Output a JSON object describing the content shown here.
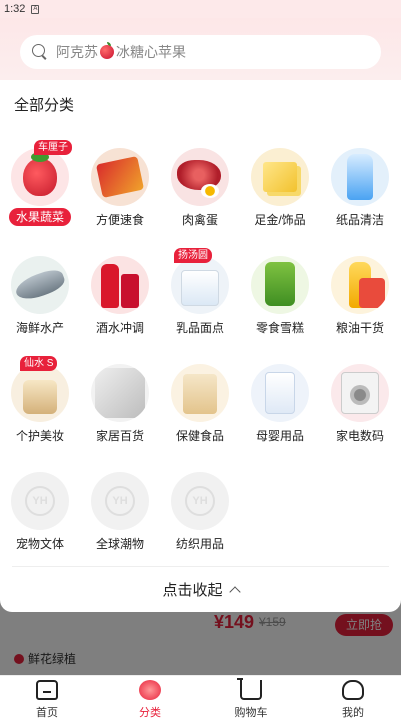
{
  "status_bar": {
    "time": "1:32"
  },
  "search": {
    "placeholder_before": "阿克苏",
    "placeholder_after": "冰糖心苹果"
  },
  "panel": {
    "title": "全部分类",
    "collapse_label": "点击收起",
    "categories": [
      {
        "label": "水果蔬菜",
        "badge": "车厘子",
        "icon": "strawberry-icon",
        "active": true
      },
      {
        "label": "方便速食",
        "icon": "instant-noodle-icon"
      },
      {
        "label": "肉禽蛋",
        "icon": "meat-icon"
      },
      {
        "label": "足金/饰品",
        "icon": "gold-icon"
      },
      {
        "label": "纸品清洁",
        "icon": "detergent-icon"
      },
      {
        "label": "海鲜水产",
        "icon": "fish-icon"
      },
      {
        "label": "酒水冲调",
        "icon": "cola-icon"
      },
      {
        "label": "乳品面点",
        "badge": "扬汤圆",
        "icon": "milk-icon"
      },
      {
        "label": "零食雪糕",
        "icon": "chips-icon"
      },
      {
        "label": "粮油干货",
        "icon": "oil-icon"
      },
      {
        "label": "个护美妆",
        "badge": "仙水 S",
        "icon": "skincare-icon"
      },
      {
        "label": "家居百货",
        "icon": "household-icon"
      },
      {
        "label": "保健食品",
        "icon": "health-food-icon"
      },
      {
        "label": "母婴用品",
        "icon": "baby-formula-icon"
      },
      {
        "label": "家电数码",
        "icon": "washer-icon"
      },
      {
        "label": "宠物文体",
        "icon": "placeholder-logo-icon"
      },
      {
        "label": "全球潮物",
        "icon": "placeholder-logo-icon"
      },
      {
        "label": "纺织用品",
        "icon": "placeholder-logo-icon"
      }
    ]
  },
  "background": {
    "price": "¥149",
    "old_price": "¥159",
    "buy_label": "立即抢",
    "section_label": "鲜花绿植"
  },
  "tabbar": [
    {
      "label": "首页",
      "icon": "home-icon"
    },
    {
      "label": "分类",
      "icon": "category-icon",
      "active": true
    },
    {
      "label": "购物车",
      "icon": "cart-icon"
    },
    {
      "label": "我的",
      "icon": "profile-icon"
    }
  ],
  "colors": {
    "accent": "#e8213b",
    "header_bg": "#fde7e8"
  }
}
